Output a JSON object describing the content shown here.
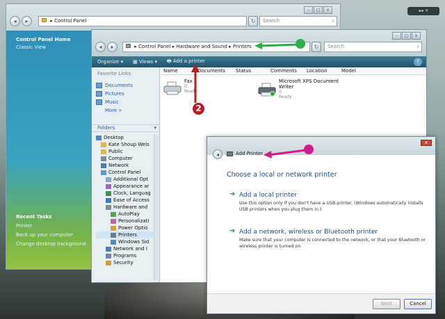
{
  "cp_window": {
    "address": "Control Panel",
    "search_placeholder": "Search",
    "sidebar": {
      "links": [
        "Control Panel Home",
        "Classic View"
      ],
      "recent_tasks_title": "Recent Tasks",
      "recent_tasks": [
        "Printer",
        "Back up your computer",
        "Change desktop background"
      ]
    }
  },
  "printers_window": {
    "breadcrumb": [
      "Control Panel",
      "Hardware and Sound",
      "Printers"
    ],
    "search_placeholder": "Search",
    "toolbar": {
      "organize": "Organize",
      "views": "Views",
      "add_printer": "Add a printer"
    },
    "favorite_links_title": "Favorite Links",
    "favorite_links": [
      "Documents",
      "Pictures",
      "Music"
    ],
    "more_label": "More »",
    "folders_title": "Folders",
    "folders": [
      "Desktop",
      "Kate Shoup Wels",
      "Public",
      "Computer",
      "Network",
      "Control Panel",
      "Additional Opt",
      "Appearance ar",
      "Clock, Languag",
      "Ease of Access",
      "Hardware and",
      "AutoPlay",
      "Personalizati",
      "Power Optio",
      "Printers",
      "Windows Sid",
      "Network and I",
      "Programs",
      "Security"
    ],
    "columns": [
      "Name",
      "Documents",
      "Status",
      "Comments",
      "Location",
      "Model"
    ],
    "printers": [
      {
        "name": "Fax",
        "docs": "0",
        "status": "Ready"
      },
      {
        "name": "Microsoft XPS Document Writer",
        "docs": "0",
        "status": "Ready"
      }
    ]
  },
  "add_printer_dialog": {
    "title": "Add Printer",
    "heading": "Choose a local or network printer",
    "options": [
      {
        "title": "Add a local printer",
        "desc": "Use this option only if you don't have a USB printer. (Windows automatically installs USB printers when you plug them in.)"
      },
      {
        "title": "Add a network, wireless or Bluetooth printer",
        "desc": "Make sure that your computer is connected to the network, or that your Bluetooth or wireless printer is turned on."
      }
    ],
    "next_label": "Next",
    "cancel_label": "Cancel"
  },
  "annotations": {
    "step_number": "2",
    "arrow_color": "#2fae4c",
    "arrow_color_2": "#d01c8b",
    "badge_color": "#b91b22"
  }
}
